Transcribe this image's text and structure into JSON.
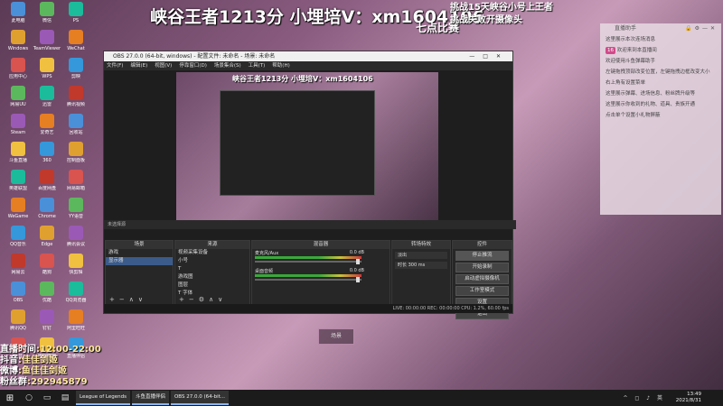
{
  "overlay": {
    "title": "峡谷王者1213分 小埋培V：xm1604106",
    "subtitle": "七点比赛",
    "right_line1": "挑战15天峡谷小号上王者",
    "right_line2": "挑战失败开摄像头"
  },
  "stream_info": {
    "time_label": "直播时间",
    "time_value": ":12:00-22:00",
    "douyin_label": "抖音",
    "douyin_value": ":佳佳剑姬",
    "weibo_label": "微博",
    "weibo_value": ":鱼佳佳剑姬",
    "fans_label": "粉丝群",
    "fans_value": ":292945879"
  },
  "obs": {
    "title": "OBS 27.0.0 (64-bit, windows) - 配置文件: 未命名 - 场景: 未命名",
    "menu": [
      "文件(F)",
      "编辑(E)",
      "视图(V)",
      "停靠窗口(D)",
      "场景集合(S)",
      "工具(T)",
      "帮助(H)"
    ],
    "preview_title": "峡谷王者1213分 小埋培V：xm1604106",
    "source_toolbar": "未选择源",
    "docks": {
      "scenes": {
        "title": "场景",
        "items": [
          "游戏",
          "显示器"
        ]
      },
      "sources": {
        "title": "来源",
        "items": [
          "视频采集设备",
          "小号",
          "T",
          "游戏图",
          "图层",
          "T 字体"
        ]
      },
      "mixer": {
        "title": "混音器",
        "tracks": [
          {
            "name": "麦克风/Aux",
            "db": "0.0 dB"
          },
          {
            "name": "桌面音频",
            "db": "0.0 dB"
          }
        ]
      },
      "transitions": {
        "title": "转场特效",
        "type": "淡出",
        "duration_label": "时长",
        "duration": "300 ms"
      },
      "controls": {
        "title": "控件",
        "buttons": [
          "停止推流",
          "开始录制",
          "启动虚拟摄像机",
          "工作室模式",
          "设置",
          "退出"
        ]
      }
    },
    "status": "LIVE: 00:00:00   REC: 00:00:00   CPU: 1.2%, 60.00 fps"
  },
  "chat": {
    "title": "直播助手",
    "messages": [
      "这里展示本次连场消息",
      "欢迎来到本直播间",
      "欢迎使用斗鱼弹幕助手",
      "左键拖拽顶部改变位置，左键拖拽边框改变大小",
      "右上角有设置菜单",
      "这里展示弹幕、进场信息、粉丝牌升级等",
      "这里展示你收到的礼物、道具、贵族开通",
      "点击单个设置小礼物屏蔽"
    ],
    "badge": "16"
  },
  "scene_button": "场景",
  "taskbar": {
    "apps": [
      "League of Legends",
      "斗鱼直播伴侣",
      "OBS 27.0.0 (64-bit..."
    ],
    "time": "13:49",
    "date": "2021/8/31"
  },
  "desktop_icons": [
    "此电脑",
    "Windows",
    "应用中心",
    "网易UU",
    "Steam",
    "斗鱼直播",
    "英雄联盟",
    "WeGame",
    "QQ音乐",
    "网易云",
    "OBS",
    "腾讯QQ",
    "抖音",
    "微信",
    "TeamViewer",
    "WPS",
    "迅雷",
    "爱奇艺",
    "360",
    "百度网盘",
    "Chrome",
    "Edge",
    "酷狗",
    "优酷",
    "钉钉",
    "哔哩哔哩",
    "PS",
    "WeChat",
    "剪映",
    "腾讯视频",
    "回收站",
    "控制面板",
    "网易邮箱",
    "YY语音",
    "腾讯会议",
    "快剪辑",
    "QQ浏览器",
    "阿里旺旺",
    "直播伴侣"
  ]
}
